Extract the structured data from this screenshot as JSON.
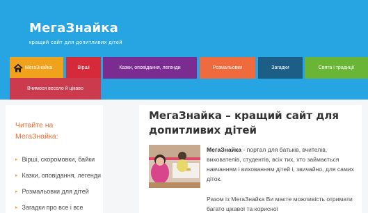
{
  "header": {
    "site_title": "МегаЗнайка",
    "tagline": "кращий сайт для допитливих дітей"
  },
  "nav": {
    "items": [
      {
        "label": "МегаЗнайка",
        "color": "#f0a21d",
        "icon": "home-icon"
      },
      {
        "label": "Вірші",
        "color": "#d6293a"
      },
      {
        "label": "Казки, оповідання, легенди",
        "color": "#7b2c91"
      },
      {
        "label": "Розмальовки",
        "color": "#ef6b3e"
      },
      {
        "label": "Загадки",
        "color": "#1d5e86"
      },
      {
        "label": "Свята і традиції",
        "color": "#6ab536"
      },
      {
        "label": "Вчимося весело й цікаво",
        "color": "#cc3b4d"
      }
    ]
  },
  "sidebar": {
    "heading_line1": "Читайте на",
    "heading_line2": "МегаЗнайка:",
    "links": [
      {
        "label": "Вірші, скоромовки, байки"
      },
      {
        "label": "Казки, оповідання, легенди"
      },
      {
        "label": "Розмальовки для дітей"
      },
      {
        "label": "Загадки про все і все"
      }
    ]
  },
  "article": {
    "title_line1": "МегаЗнайка – кращий сайт для",
    "title_line2": "допитливих дітей",
    "p1_bold": "МегаЗнайка",
    "p1_rest": " - портал для батьків, вчителів, вихователів, студентів, всіх тих, хто займається навчанням і вихованням дітей і, звичайно, для самих діток.",
    "p2": "Разом із МегаЗнайка Ви маєте можливість отримати багато цікавої та корисної"
  },
  "colors": {
    "header_bg": "#27a4e2",
    "sidebar_heading": "#f2692f",
    "bullet": "#f2a23a"
  }
}
